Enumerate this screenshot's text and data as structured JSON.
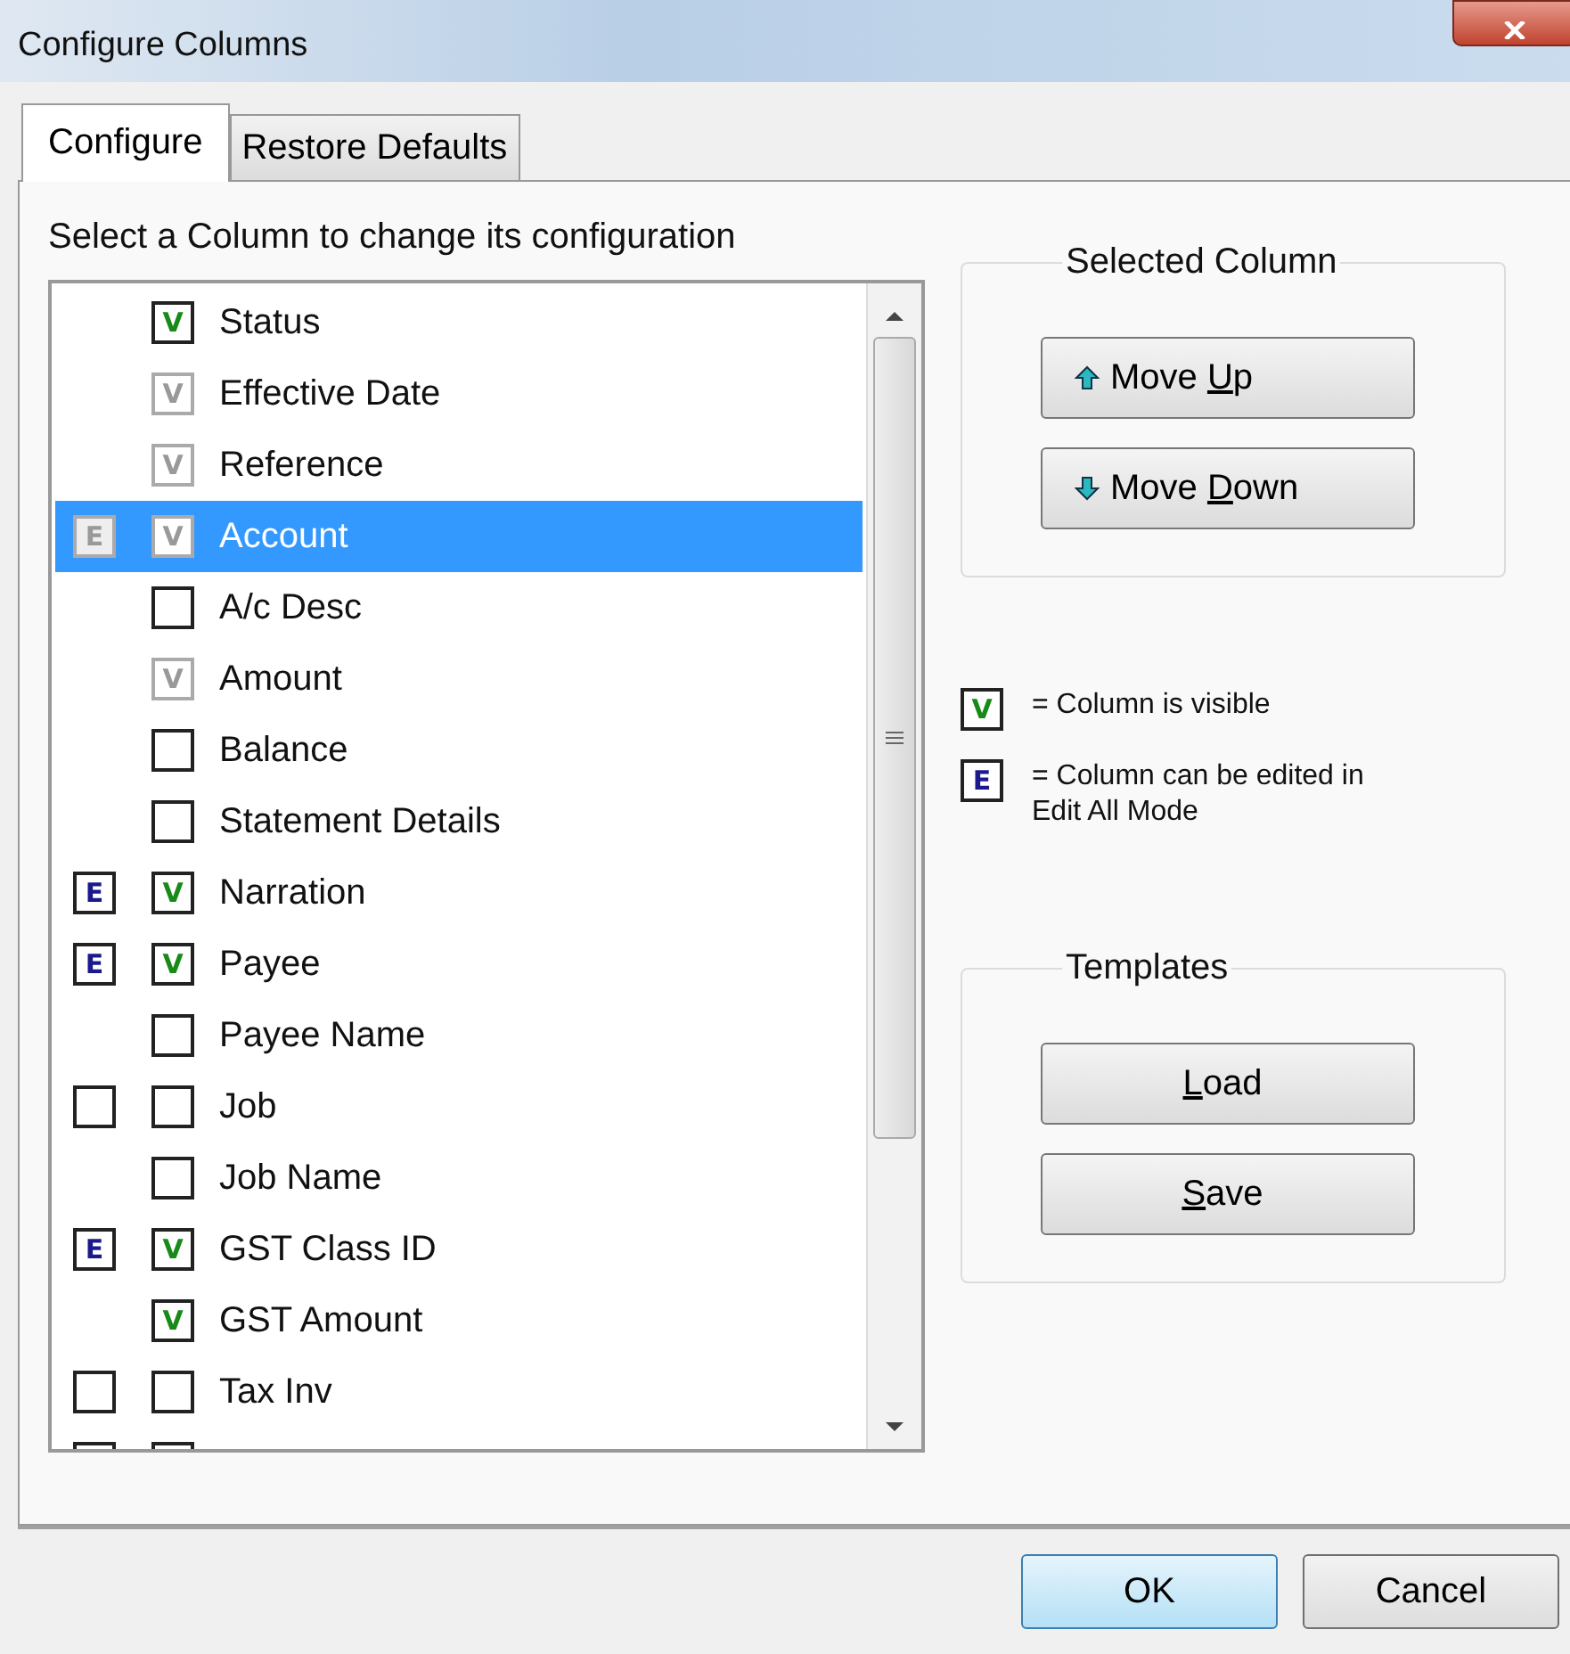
{
  "window": {
    "title": "Configure Columns"
  },
  "tabs": [
    {
      "label": "Configure",
      "selected": true
    },
    {
      "label": "Restore Defaults",
      "selected": false
    }
  ],
  "instruction": "Select a Column to change its configuration",
  "columns": [
    {
      "label": "Status",
      "visible": {
        "mark": "V",
        "disabled": false
      },
      "selected": false
    },
    {
      "label": "Effective Date",
      "visible": {
        "mark": "V",
        "disabled": true
      },
      "selected": false
    },
    {
      "label": "Reference",
      "visible": {
        "mark": "V",
        "disabled": true
      },
      "selected": false
    },
    {
      "label": "Account",
      "edit": {
        "mark": "E",
        "disabled": true
      },
      "visible": {
        "mark": "V",
        "disabled": true
      },
      "selected": true
    },
    {
      "label": "A/c Desc",
      "visible": {
        "disabled": false
      },
      "selected": false
    },
    {
      "label": "Amount",
      "visible": {
        "mark": "V",
        "disabled": true
      },
      "selected": false
    },
    {
      "label": "Balance",
      "visible": {
        "disabled": false
      },
      "selected": false
    },
    {
      "label": "Statement Details",
      "visible": {
        "disabled": false
      },
      "selected": false
    },
    {
      "label": "Narration",
      "edit": {
        "mark": "E",
        "disabled": false
      },
      "visible": {
        "mark": "V",
        "disabled": false
      },
      "selected": false
    },
    {
      "label": "Payee",
      "edit": {
        "mark": "E",
        "disabled": false
      },
      "visible": {
        "mark": "V",
        "disabled": false
      },
      "selected": false
    },
    {
      "label": "Payee Name",
      "visible": {
        "disabled": false
      },
      "selected": false
    },
    {
      "label": "Job",
      "edit": {
        "disabled": false
      },
      "visible": {
        "disabled": false
      },
      "selected": false
    },
    {
      "label": "Job Name",
      "visible": {
        "disabled": false
      },
      "selected": false
    },
    {
      "label": "GST Class ID",
      "edit": {
        "mark": "E",
        "disabled": false
      },
      "visible": {
        "mark": "V",
        "disabled": false
      },
      "selected": false
    },
    {
      "label": "GST Amount",
      "visible": {
        "mark": "V",
        "disabled": false
      },
      "selected": false
    },
    {
      "label": "Tax Inv",
      "edit": {
        "disabled": false
      },
      "visible": {
        "disabled": false
      },
      "selected": false
    },
    {
      "edit": {
        "disabled": false
      },
      "visible": {
        "disabled": false
      },
      "selected": false
    }
  ],
  "selected_column": {
    "title": "Selected Column",
    "buttons": [
      {
        "kind": "up",
        "before": "Move ",
        "key": "U",
        "after": "p"
      },
      {
        "kind": "down",
        "before": "Move ",
        "key": "D",
        "after": "own"
      }
    ]
  },
  "legend": [
    {
      "kind": "visible",
      "glyph": "V",
      "text": "= Column is visible"
    },
    {
      "kind": "edit",
      "glyph": "E",
      "text": "= Column can be edited in Edit All Mode"
    }
  ],
  "templates": {
    "title": "Templates",
    "buttons": [
      {
        "key": "L",
        "after": "oad"
      },
      {
        "key": "S",
        "after": "ave"
      }
    ]
  },
  "footer": {
    "buttons": [
      {
        "label": "OK",
        "default": true
      },
      {
        "label": "Cancel",
        "default": false
      }
    ]
  }
}
